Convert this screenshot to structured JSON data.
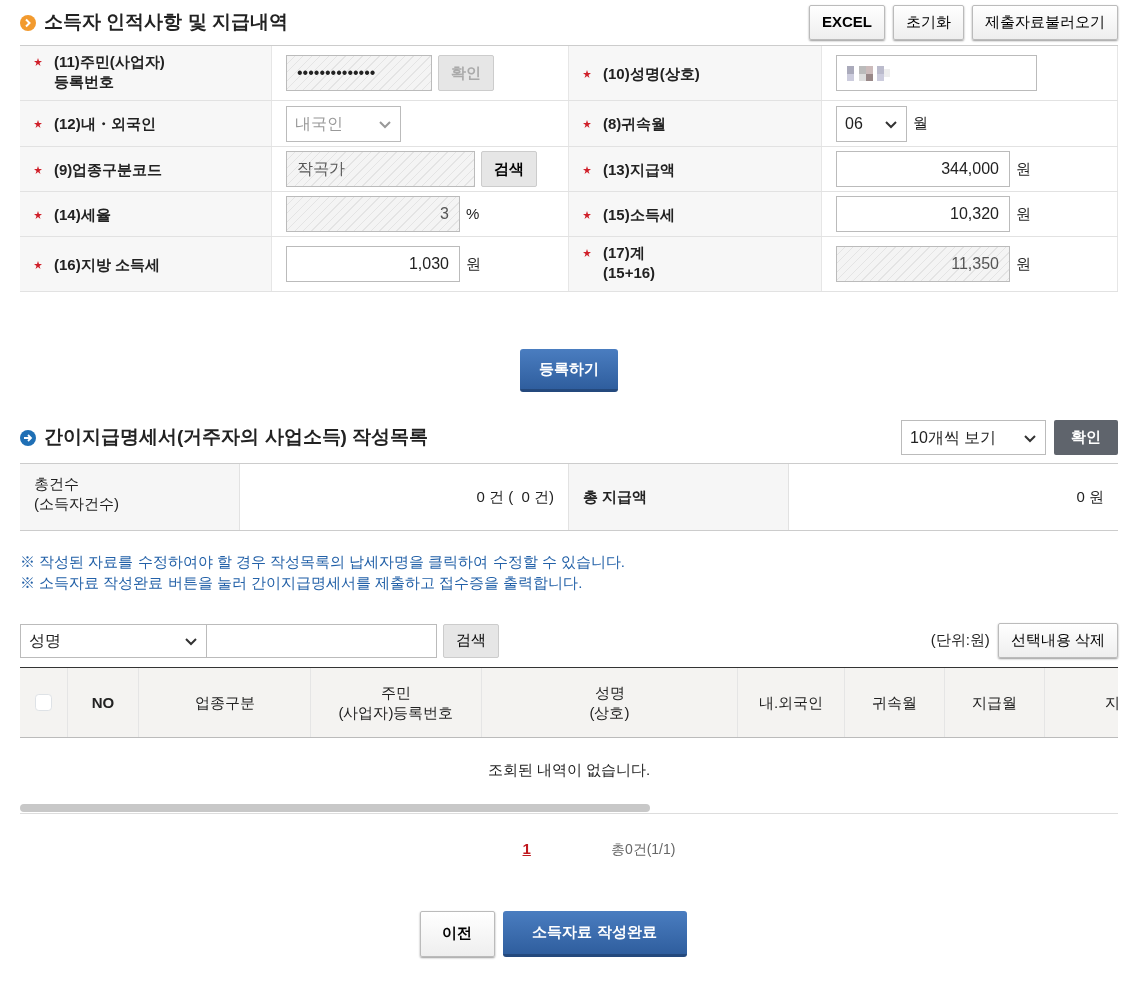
{
  "section1": {
    "title": "소득자 인적사항 및 지급내역",
    "buttons": [
      {
        "label": "EXCEL",
        "bold": true
      },
      {
        "label": "초기화",
        "bold": false
      },
      {
        "label": "제출자료불러오기",
        "bold": false
      }
    ]
  },
  "form_rows": [
    [
      {
        "label": "(11)주민(사업자)\n등록번호",
        "required": true,
        "kind": "text",
        "value": "••••••••••••••",
        "readonly": true,
        "button": {
          "label": "확인",
          "disabled": true
        }
      },
      {
        "label": "(10)성명(상호)",
        "required": true,
        "kind": "blurred"
      }
    ],
    [
      {
        "label": "(12)내・외국인",
        "required": true,
        "kind": "select",
        "value": "내국인",
        "disabled": true
      },
      {
        "label": "(8)귀속월",
        "required": true,
        "kind": "select",
        "value": "06",
        "disabled": false,
        "unit": "월"
      }
    ],
    [
      {
        "label": "(9)업종구분코드",
        "required": true,
        "kind": "text",
        "value": "작곡가",
        "readonly": true,
        "button": {
          "label": "검색",
          "disabled": false
        }
      },
      {
        "label": "(13)지급액",
        "required": true,
        "kind": "number",
        "value": "344,000",
        "readonly": false,
        "unit": "원"
      }
    ],
    [
      {
        "label": "(14)세율",
        "required": true,
        "kind": "number",
        "value": "3",
        "readonly": true,
        "unit": "%"
      },
      {
        "label": "(15)소득세",
        "required": true,
        "kind": "number",
        "value": "10,320",
        "readonly": false,
        "unit": "원"
      }
    ],
    [
      {
        "label": "(16)지방 소득세",
        "required": true,
        "kind": "number",
        "value": "1,030",
        "readonly": false,
        "unit": "원"
      },
      {
        "label": "(17)계\n(15+16)",
        "required": true,
        "kind": "number",
        "value": "11,350",
        "readonly": true,
        "unit": "원"
      }
    ]
  ],
  "register_button": "등록하기",
  "section2": {
    "title": "간이지급명세서(거주자의 사업소득) 작성목록",
    "page_size": "10개씩 보기",
    "confirm_button": "확인",
    "summary": [
      {
        "label": "총건수\n(소득자건수)",
        "value": "0 건 (  0 건)"
      },
      {
        "label": "총 지급액",
        "value": "0 원"
      }
    ],
    "notes": [
      "※ 작성된 자료를 수정하여야 할 경우 작성목록의 납세자명을 클릭하여 수정할 수 있습니다.",
      "※ 소득자료 작성완료 버튼을 눌러 간이지급명세서를 제출하고 접수증을 출력합니다."
    ],
    "search": {
      "field": "성명",
      "button": "검색"
    },
    "unit_note": "(단위:원)",
    "delete_button": "선택내용 삭제",
    "table": {
      "select_all": {
        "checked": false
      },
      "columns": [
        "NO",
        "업종구분",
        "주민\n(사업자)등록번호",
        "성명\n(상호)",
        "내.외국인",
        "귀속월",
        "지급월",
        "지"
      ],
      "empty_message": "조회된 내역이 없습니다."
    },
    "pagination": {
      "pages": [
        {
          "label": "1",
          "selected": true
        }
      ],
      "total": "총0건(1/1)"
    }
  },
  "footer_buttons": [
    {
      "label": "이전",
      "kind": "secondary"
    },
    {
      "label": "소득자료 작성완료",
      "kind": "primary"
    }
  ]
}
